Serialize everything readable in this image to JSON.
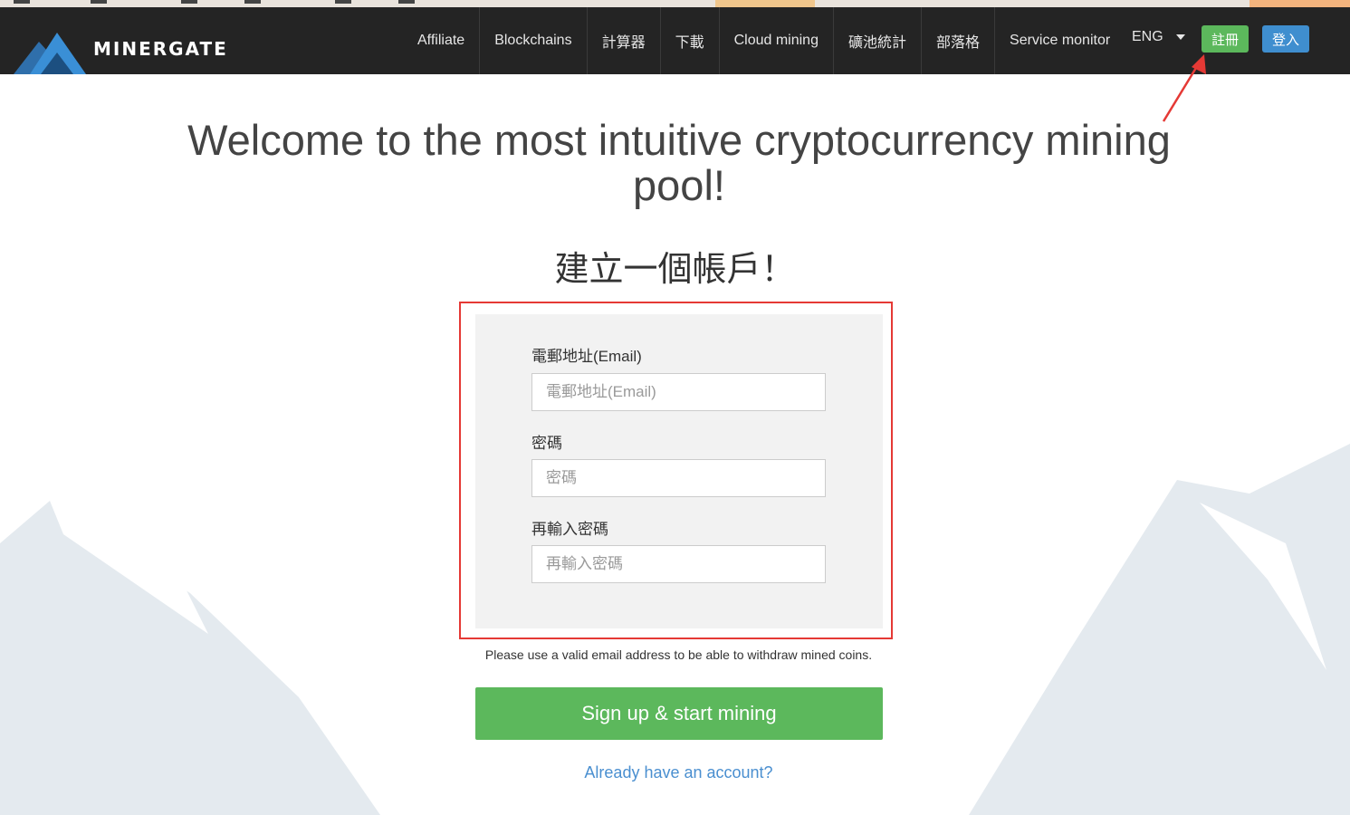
{
  "nav": {
    "logo_text": "MinerGate",
    "items": [
      {
        "label": "Affiliate"
      },
      {
        "label": "Blockchains"
      },
      {
        "label": "計算器"
      },
      {
        "label": "下載"
      },
      {
        "label": "Cloud mining"
      },
      {
        "label": "礦池統計"
      },
      {
        "label": "部落格"
      },
      {
        "label": "Service monitor"
      }
    ],
    "language": "ENG",
    "register_label": "註冊",
    "login_label": "登入"
  },
  "hero": {
    "headline": "Welcome to the most intuitive cryptocurrency mining pool!",
    "subhead": "建立一個帳戶！"
  },
  "form": {
    "email_label": "電郵地址(Email)",
    "email_placeholder": "電郵地址(Email)",
    "password_label": "密碼",
    "password_placeholder": "密碼",
    "confirm_label": "再輸入密碼",
    "confirm_placeholder": "再輸入密碼",
    "note": "Please use a valid email address to be able to withdraw mined coins.",
    "submit_label": "Sign up & start mining",
    "already_link": "Already have an account?"
  },
  "colors": {
    "navbar_bg": "#242424",
    "register_green": "#5cb85c",
    "login_blue": "#3f8ecf",
    "highlight_red": "#e53935",
    "link_blue": "#4a8fd0",
    "mountain": "#e4eaef"
  }
}
